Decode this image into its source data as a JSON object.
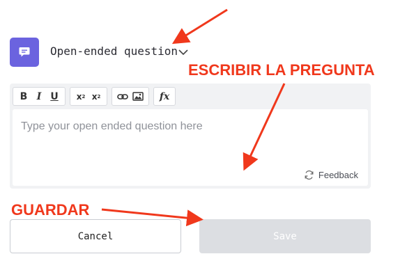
{
  "question_type": {
    "icon": "message-icon",
    "label": "Open-ended question"
  },
  "toolbar": {
    "bold": "B",
    "italic": "I",
    "underline": "U",
    "superscript": "x",
    "superscript_mark": "2",
    "subscript": "x",
    "subscript_mark": "2",
    "link_icon": "link-icon",
    "image_icon": "image-icon",
    "formula": "fx"
  },
  "editor": {
    "placeholder": "Type your open ended question here",
    "feedback_label": "Feedback"
  },
  "actions": {
    "cancel_label": "Cancel",
    "save_label": "Save"
  },
  "annotations": {
    "write_question": "ESCRIBIR LA PREGUNTA",
    "save": "GUARDAR",
    "color": "#f0381c"
  },
  "colors": {
    "accent": "#6b63df",
    "save_disabled": "#dcdee2"
  }
}
